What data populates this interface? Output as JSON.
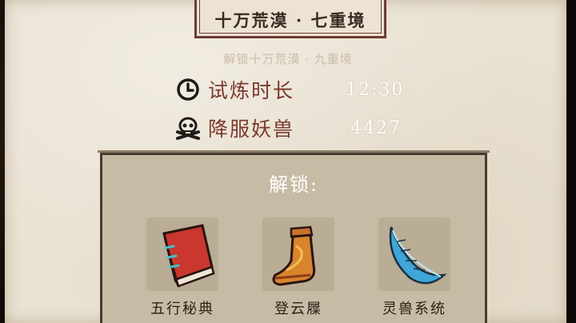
{
  "header": {
    "title": "十万荒漠 · 七重境"
  },
  "unlock_hint": "解锁十万荒漠 · 九重境",
  "stats": [
    {
      "icon": "clock-icon",
      "label": "试炼时长",
      "value": "12:30"
    },
    {
      "icon": "skull-crossbones-icon",
      "label": "降服妖兽",
      "value": "4427"
    }
  ],
  "unlock_panel": {
    "title": "解锁:",
    "rewards": [
      {
        "icon": "red-book-icon",
        "name": "五行秘典"
      },
      {
        "icon": "boot-icon",
        "name": "登云屧"
      },
      {
        "icon": "blue-feather-icon",
        "name": "灵兽系统"
      }
    ]
  },
  "colors": {
    "paper": "#e9e1d1",
    "frame": "#6e3b32",
    "stat_label": "#7a3a2c",
    "panel": "#c6bba4"
  }
}
